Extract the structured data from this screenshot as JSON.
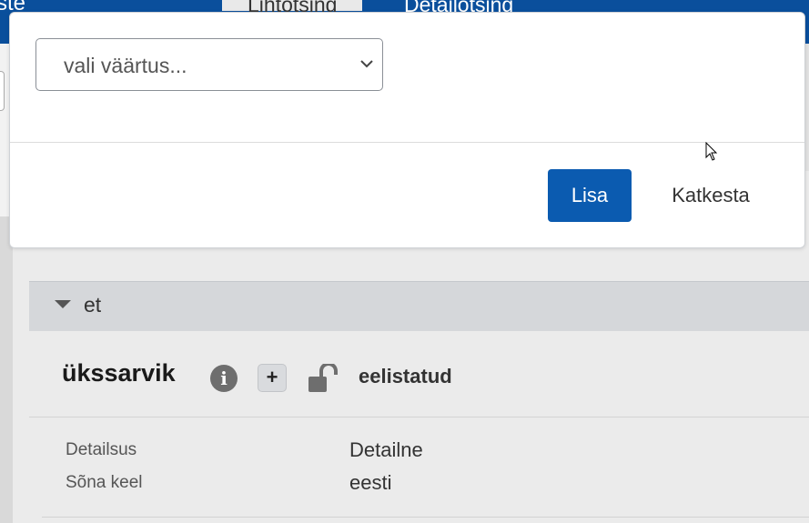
{
  "background": {
    "brand_fragment": "ste",
    "tabs": [
      {
        "label": "Lihtotsing"
      },
      {
        "label": "Detailotsing"
      }
    ]
  },
  "language_section": {
    "label": "et"
  },
  "word": {
    "title": "ükssarvik",
    "preference": "eelistatud",
    "icons": [
      "info-icon",
      "plus-icon",
      "unlock-icon"
    ]
  },
  "properties": [
    {
      "label": "Detailsus",
      "value": "Detailne"
    },
    {
      "label": "Sõna keel",
      "value": "eesti"
    }
  ],
  "modal": {
    "select": {
      "placeholder": "vali väärtus..."
    },
    "buttons": {
      "add": "Lisa",
      "cancel": "Katkesta"
    }
  },
  "colors": {
    "primary": "#0b5bb0",
    "topbar": "#0a4f9c",
    "lang_header": "#d5d7da"
  }
}
